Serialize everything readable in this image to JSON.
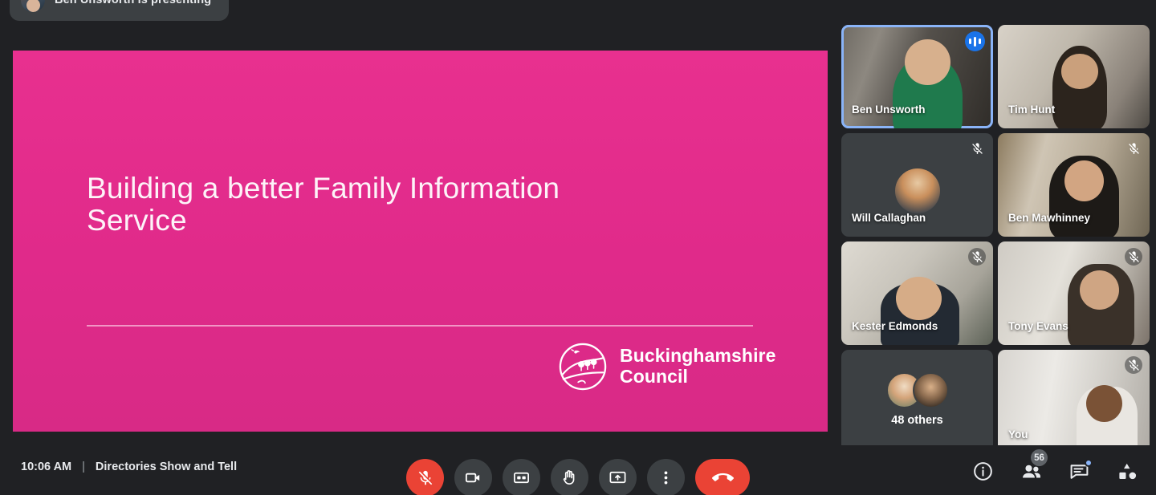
{
  "banner": {
    "presenter_text": "Ben Unsworth is presenting",
    "avatar_name": "presenter-avatar"
  },
  "slide": {
    "title": "Building a better Family Information Service",
    "logo_text": "Buckinghamshire\nCouncil",
    "logo_alt": "buckinghamshire-council-logo",
    "background_color": "#e62a8b",
    "title_color": "#fdf3f8"
  },
  "participants": [
    {
      "name": "Ben Unsworth",
      "muted": false,
      "speaking": true,
      "camera_on": true,
      "active_speaker": true,
      "tile_class": "bg-ben"
    },
    {
      "name": "Tim Hunt",
      "muted": false,
      "speaking": false,
      "camera_on": true,
      "active_speaker": false,
      "tile_class": "bg-tim"
    },
    {
      "name": "Will Callaghan",
      "muted": true,
      "speaking": false,
      "camera_on": false,
      "active_speaker": false,
      "tile_class": ""
    },
    {
      "name": "Ben Mawhinney",
      "muted": true,
      "speaking": false,
      "camera_on": true,
      "active_speaker": false,
      "tile_class": "bg-mawh"
    },
    {
      "name": "Kester Edmonds",
      "muted": true,
      "speaking": false,
      "camera_on": true,
      "active_speaker": false,
      "tile_class": "bg-kester"
    },
    {
      "name": "Tony Evans",
      "muted": true,
      "speaking": false,
      "camera_on": true,
      "active_speaker": false,
      "tile_class": "bg-tony"
    },
    {
      "name": "48 others",
      "muted": false,
      "speaking": false,
      "camera_on": false,
      "active_speaker": false,
      "is_overflow": true,
      "tile_class": ""
    },
    {
      "name": "You",
      "muted": true,
      "speaking": false,
      "camera_on": true,
      "active_speaker": false,
      "tile_class": "bg-you"
    }
  ],
  "bottombar": {
    "time": "10:06 AM",
    "separator": "|",
    "meeting_name": "Directories Show and Tell",
    "controls": [
      {
        "name": "microphone-off-button",
        "label": "Turn on microphone",
        "state": "muted",
        "style": "danger"
      },
      {
        "name": "camera-button",
        "label": "Turn off camera",
        "state": "on",
        "style": "normal"
      },
      {
        "name": "captions-button",
        "label": "Turn on captions",
        "state": "off",
        "style": "normal"
      },
      {
        "name": "raise-hand-button",
        "label": "Raise hand",
        "state": "off",
        "style": "normal"
      },
      {
        "name": "present-now-button",
        "label": "Present now",
        "state": "off",
        "style": "normal"
      },
      {
        "name": "more-options-button",
        "label": "More options",
        "state": "off",
        "style": "normal"
      },
      {
        "name": "leave-call-button",
        "label": "Leave call",
        "state": "off",
        "style": "hangup"
      }
    ],
    "right_icons": [
      {
        "name": "meeting-details-icon",
        "label": "Meeting details",
        "badge": ""
      },
      {
        "name": "people-icon",
        "label": "Show everyone",
        "badge": "56"
      },
      {
        "name": "chat-icon",
        "label": "Chat with everyone",
        "badge": "",
        "dot": true
      },
      {
        "name": "activities-icon",
        "label": "Activities",
        "badge": ""
      }
    ]
  },
  "colors": {
    "background": "#202124",
    "tile_background": "#3c4043",
    "accent_blue": "#8ab4f8",
    "danger_red": "#ea4335",
    "slide_pink": "#e62a8b"
  }
}
